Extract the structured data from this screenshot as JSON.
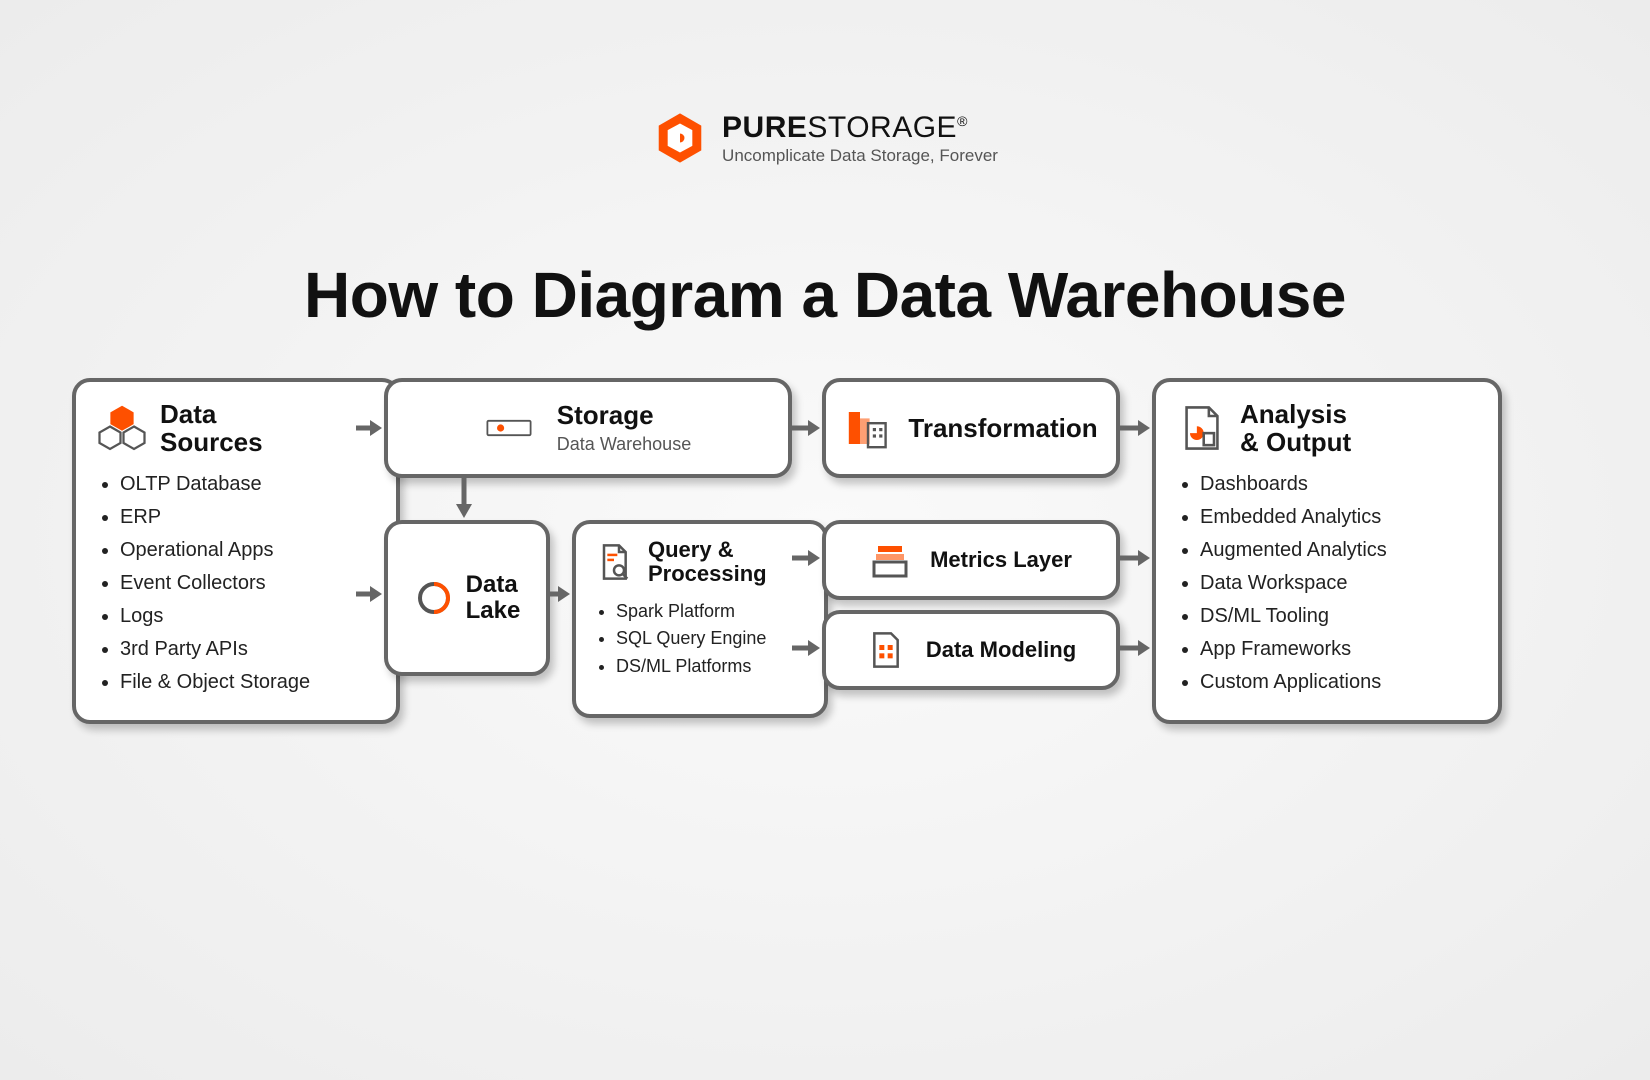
{
  "brand": {
    "name_bold": "PURE",
    "name_thin": "STORAGE",
    "reg": "®",
    "tagline": "Uncomplicate Data Storage, Forever"
  },
  "headline": "How to Diagram a Data Warehouse",
  "stages": {
    "sources": {
      "title": "Data\nSources",
      "items": [
        "OLTP Database",
        "ERP",
        "Operational Apps",
        "Event Collectors",
        "Logs",
        "3rd Party APIs",
        "File & Object Storage"
      ]
    },
    "storage": {
      "title": "Storage",
      "subtitle": "Data Warehouse"
    },
    "transformation": {
      "title": "Transformation"
    },
    "data_lake": {
      "title": "Data\nLake"
    },
    "query": {
      "title": "Query &\nProcessing",
      "items": [
        "Spark Platform",
        "SQL Query Engine",
        "DS/ML Platforms"
      ]
    },
    "metrics": {
      "title": "Metrics Layer"
    },
    "modeling": {
      "title": "Data Modeling"
    },
    "output": {
      "title": "Analysis\n& Output",
      "items": [
        "Dashboards",
        "Embedded Analytics",
        "Augmented Analytics",
        "Data Workspace",
        "DS/ML Tooling",
        "App Frameworks",
        "Custom Applications"
      ]
    }
  },
  "flow": [
    [
      "sources",
      "storage"
    ],
    [
      "sources",
      "data_lake"
    ],
    [
      "storage",
      "data_lake"
    ],
    [
      "storage",
      "transformation"
    ],
    [
      "transformation",
      "output"
    ],
    [
      "data_lake",
      "query"
    ],
    [
      "query",
      "metrics"
    ],
    [
      "query",
      "modeling"
    ],
    [
      "metrics",
      "output"
    ],
    [
      "modeling",
      "output"
    ]
  ],
  "colors": {
    "accent": "#fe5000",
    "border": "#666666"
  }
}
